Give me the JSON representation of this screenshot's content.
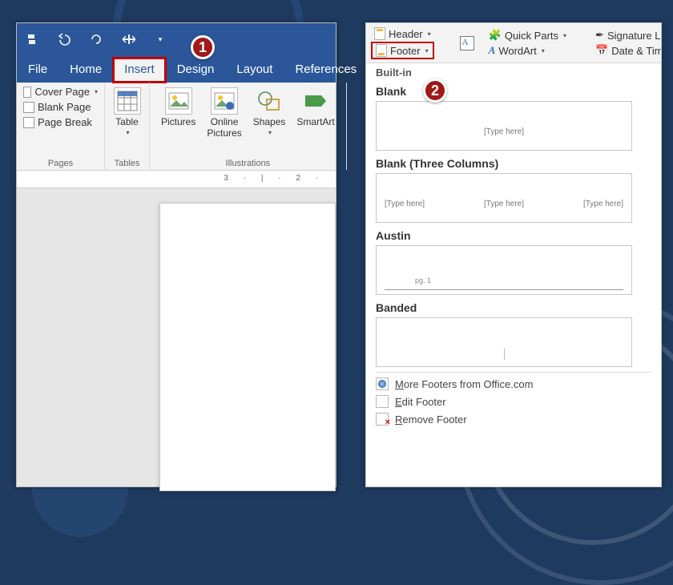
{
  "badges": {
    "one": "1",
    "two": "2"
  },
  "left": {
    "tabs": [
      "File",
      "Home",
      "Insert",
      "Design",
      "Layout",
      "References"
    ],
    "active_tab_index": 2,
    "groups": {
      "pages": {
        "label": "Pages",
        "items": [
          "Cover Page",
          "Blank Page",
          "Page Break"
        ]
      },
      "tables": {
        "label": "Tables",
        "button": "Table"
      },
      "illustrations": {
        "label": "Illustrations",
        "buttons": [
          "Pictures",
          "Online Pictures",
          "Shapes",
          "SmartArt"
        ]
      }
    },
    "ruler": "3 · | · 2 ·"
  },
  "right": {
    "top": {
      "header": "Header",
      "footer": "Footer",
      "quick_parts": "Quick Parts",
      "wordart": "WordArt",
      "signature": "Signature Line",
      "datetime": "Date & Time"
    },
    "builtin_label": "Built-in",
    "sections": {
      "blank": {
        "title": "Blank",
        "placeholder": "[Type here]"
      },
      "blank3": {
        "title": "Blank (Three Columns)",
        "p1": "[Type here]",
        "p2": "[Type here]",
        "p3": "[Type here]"
      },
      "austin": {
        "title": "Austin",
        "pg": "pg. 1"
      },
      "banded": {
        "title": "Banded"
      }
    },
    "menu": {
      "more": "More Footers from Office.com",
      "edit": "Edit Footer",
      "remove": "Remove Footer"
    }
  }
}
